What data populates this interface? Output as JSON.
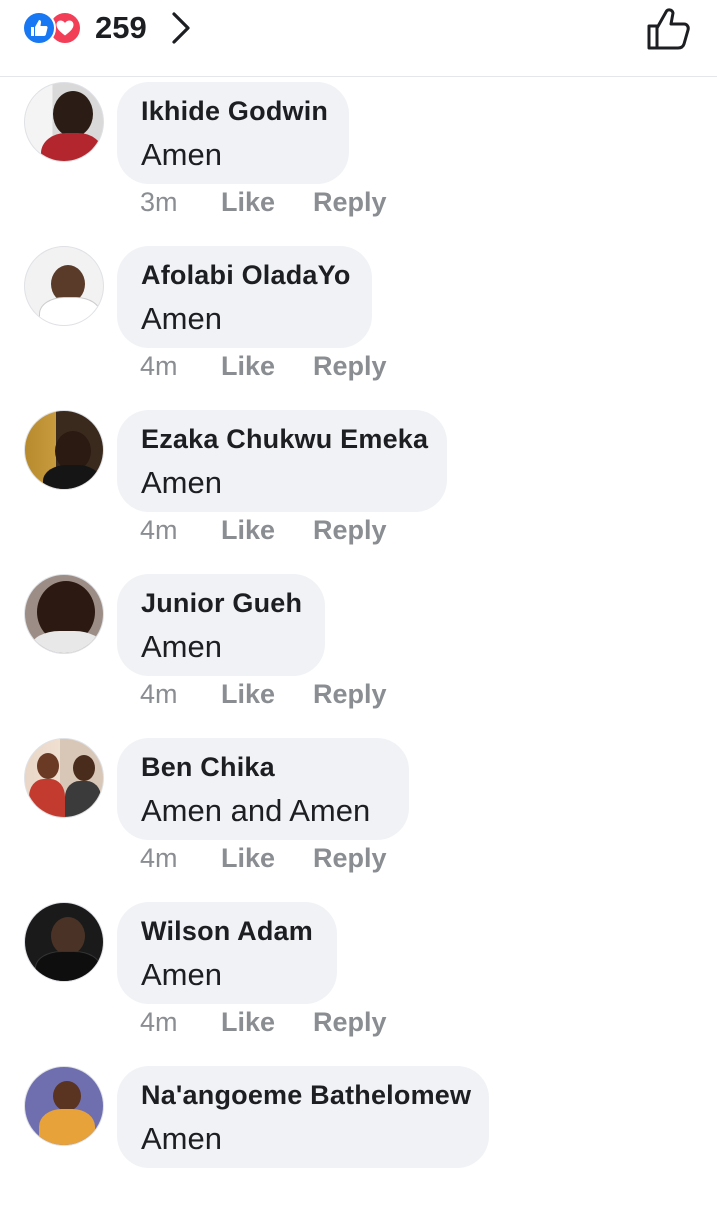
{
  "header": {
    "reaction_count": "259",
    "reaction_icons": [
      "like-reaction-icon",
      "love-reaction-icon"
    ],
    "colors": {
      "like": "#1877f2",
      "love": "#f33e58"
    }
  },
  "actions": {
    "like_label": "Like",
    "reply_label": "Reply"
  },
  "comments": [
    {
      "name": "Ikhide Godwin",
      "text": "Amen",
      "time": "3m"
    },
    {
      "name": "Afolabi OladaYo",
      "text": "Amen",
      "time": "4m"
    },
    {
      "name": "Ezaka Chukwu Emeka",
      "text": "Amen",
      "time": "4m"
    },
    {
      "name": "Junior Gueh",
      "text": "Amen",
      "time": "4m"
    },
    {
      "name": "Ben Chika",
      "text": "Amen and Amen",
      "time": "4m"
    },
    {
      "name": "Wilson Adam",
      "text": "Amen",
      "time": "4m"
    },
    {
      "name": "Na'angoeme Bathelomew",
      "text": "Amen",
      "time": ""
    }
  ]
}
